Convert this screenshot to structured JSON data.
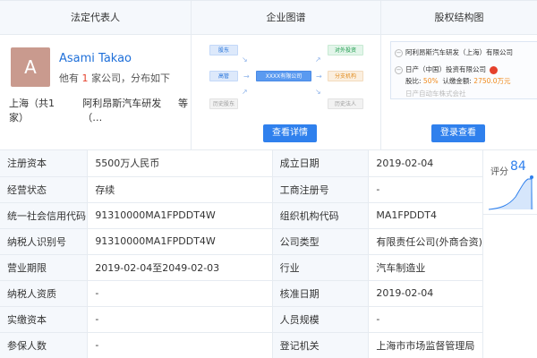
{
  "cards": {
    "rep": {
      "title": "法定代表人",
      "avatar_letter": "A",
      "name": "Asami Takao",
      "sub_prefix": "他有",
      "sub_count": "1",
      "sub_suffix": "家公司，分布如下",
      "location": "上海（共1家）",
      "company": "阿利昂斯汽车研发（…",
      "more": "等"
    },
    "graph": {
      "title": "企业图谱",
      "nodes": {
        "shareholder": "股东",
        "executive": "高管",
        "history_shareholder": "历史股东",
        "center": "XXXX有限公司",
        "investment": "对外投资",
        "branch": "分支机构",
        "history_rep": "历史法人"
      },
      "button": "查看详情"
    },
    "equity": {
      "title": "股权结构图",
      "row1": "阿利昂斯汽车研发（上海）有限公司",
      "row2": "日产（中国）投资有限公司",
      "row3_ratio_label": "股比:",
      "row3_ratio": "50%",
      "row3_amount_label": "认缴金额:",
      "row3_amount": "2750.0万元",
      "row4": "日产自动车株式会社",
      "button": "登录查看"
    }
  },
  "info": {
    "rows": [
      {
        "l1": "注册资本",
        "v1": "5500万人民币",
        "l2": "成立日期",
        "v2": "2019-02-04"
      },
      {
        "l1": "经营状态",
        "v1": "存续",
        "l2": "工商注册号",
        "v2": "-"
      },
      {
        "l1": "统一社会信用代码",
        "v1": "91310000MA1FPDDT4W",
        "l2": "组织机构代码",
        "v2": "MA1FPDDT4"
      },
      {
        "l1": "纳税人识别号",
        "v1": "91310000MA1FPDDT4W",
        "l2": "公司类型",
        "v2": "有限责任公司(外商合资)"
      },
      {
        "l1": "营业期限",
        "v1": "2019-02-04至2049-02-03",
        "l2": "行业",
        "v2": "汽车制造业"
      },
      {
        "l1": "纳税人资质",
        "v1": "-",
        "l2": "核准日期",
        "v2": "2019-02-04"
      },
      {
        "l1": "实缴资本",
        "v1": "-",
        "l2": "人员规模",
        "v2": "-"
      },
      {
        "l1": "参保人数",
        "v1": "-",
        "l2": "登记机关",
        "v2": "上海市市场监督管理局"
      }
    ]
  },
  "score": {
    "label": "评分",
    "value": "84",
    "colors": {
      "accent": "#2f80ed"
    }
  }
}
